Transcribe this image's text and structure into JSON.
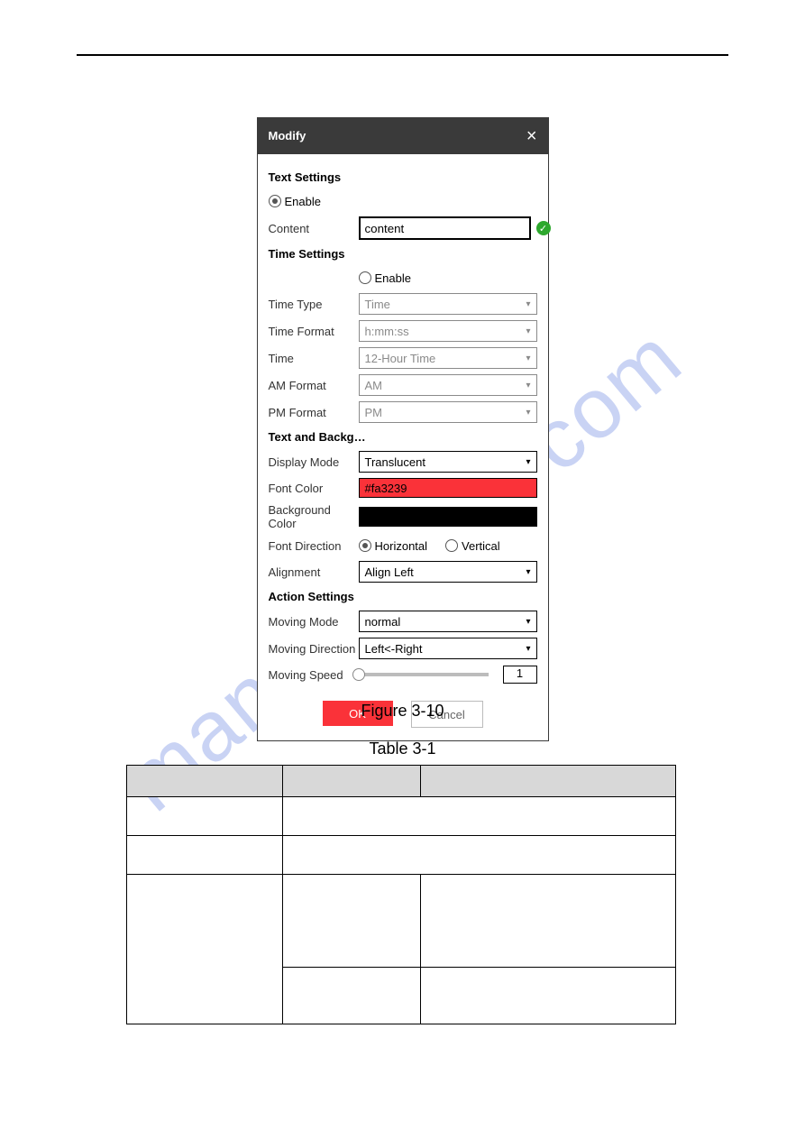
{
  "watermark": "manualchive.com",
  "dialog": {
    "title": "Modify",
    "sections": {
      "text_settings": {
        "heading": "Text Settings",
        "enable_label": "Enable",
        "content_label": "Content",
        "content_value": "content"
      },
      "time_settings": {
        "heading": "Time Settings",
        "enable_label": "Enable",
        "rows": {
          "time_type": {
            "label": "Time Type",
            "value": "Time"
          },
          "time_format": {
            "label": "Time Format",
            "value": "h:mm:ss"
          },
          "time": {
            "label": "Time",
            "value": "12-Hour Time"
          },
          "am_format": {
            "label": "AM Format",
            "value": "AM"
          },
          "pm_format": {
            "label": "PM Format",
            "value": "PM"
          }
        }
      },
      "text_bg": {
        "heading": "Text and Backg…",
        "display_mode": {
          "label": "Display Mode",
          "value": "Translucent"
        },
        "font_color": {
          "label": "Font Color",
          "value": "#fa3239"
        },
        "bg_color": {
          "label": "Background Color"
        },
        "font_direction": {
          "label": "Font Direction",
          "horizontal": "Horizontal",
          "vertical": "Vertical"
        },
        "alignment": {
          "label": "Alignment",
          "value": "Align Left"
        }
      },
      "action": {
        "heading": "Action Settings",
        "moving_mode": {
          "label": "Moving Mode",
          "value": "normal"
        },
        "moving_direction": {
          "label": "Moving Direction",
          "value": "Left<-Right"
        },
        "moving_speed": {
          "label": "Moving Speed",
          "value": "1"
        }
      }
    },
    "buttons": {
      "ok": "OK",
      "cancel": "Cancel"
    }
  },
  "captions": {
    "figure": "Figure 3-10",
    "table": "Table 3-1"
  }
}
